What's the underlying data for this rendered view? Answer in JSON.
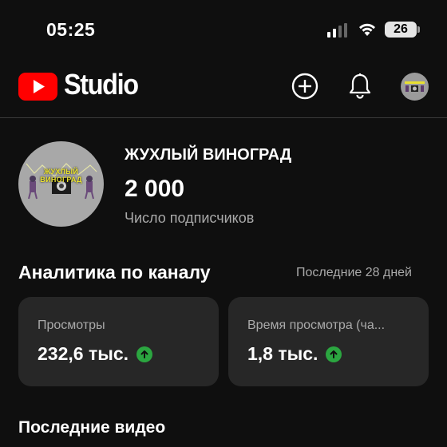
{
  "status_bar": {
    "time": "05:25",
    "battery": "26"
  },
  "header": {
    "studio_label": "Studio",
    "icons": [
      "plus-icon",
      "bell-icon",
      "avatar"
    ]
  },
  "channel": {
    "name": "ЖУХЛЫЙ ВИНОГРАД",
    "avatar_text": "ЖУХЛЫЙ ВИНОГРАД",
    "subscribers": "2 000",
    "subscribers_label": "Число подписчиков"
  },
  "analytics": {
    "title": "Аналитика по каналу",
    "period": "Последние 28 дней",
    "cards": [
      {
        "label": "Просмотры",
        "value": "232,6 тыс.",
        "trend": "up"
      },
      {
        "label": "Время просмотра (ча...",
        "value": "1,8 тыс.",
        "trend": "up"
      }
    ]
  },
  "recent": {
    "title": "Последние видео"
  },
  "colors": {
    "background": "#0f0f0f",
    "card": "#272727",
    "accent_red": "#ff0000",
    "trend_green": "#2ba640"
  }
}
